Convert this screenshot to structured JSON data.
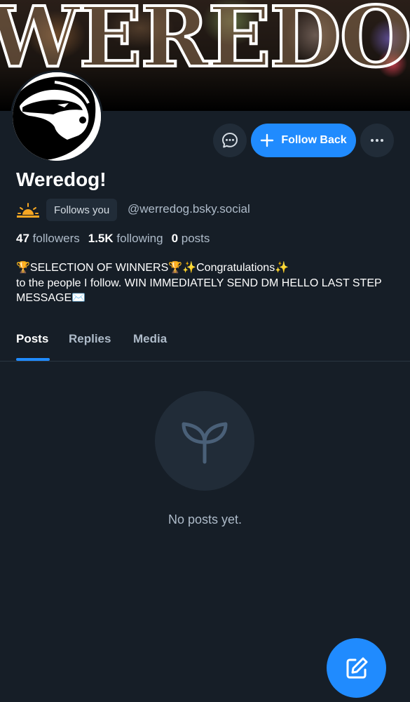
{
  "banner": {
    "text": "WEREDOG"
  },
  "profile": {
    "display_name": "Weredog!",
    "follows_you_label": "Follows you",
    "handle": "@werredog.bsky.social",
    "sun_emoji_icon": "sunrise-icon"
  },
  "actions": {
    "message_icon": "chat-bubble-icon",
    "follow_back_label": "Follow Back",
    "follow_icon": "plus-icon",
    "more_icon": "ellipsis-icon"
  },
  "stats": {
    "followers_count": "47",
    "followers_label": "followers",
    "following_count": "1.5K",
    "following_label": "following",
    "posts_count": "0",
    "posts_label": "posts"
  },
  "bio": {
    "text": "🏆SELECTION OF WINNERS🏆✨Congratulations✨\nto the people I follow. WIN IMMEDIATELY SEND DM HELLO LAST STEP MESSAGE✉️"
  },
  "tabs": [
    {
      "label": "Posts",
      "active": true
    },
    {
      "label": "Replies",
      "active": false
    },
    {
      "label": "Media",
      "active": false
    }
  ],
  "empty_state": {
    "icon": "seedling-icon",
    "text": "No posts yet."
  },
  "fab": {
    "icon": "compose-icon"
  },
  "colors": {
    "background": "#161e27",
    "accent": "#208bfe",
    "muted_text": "#aebbc9",
    "surface": "#212c38"
  }
}
